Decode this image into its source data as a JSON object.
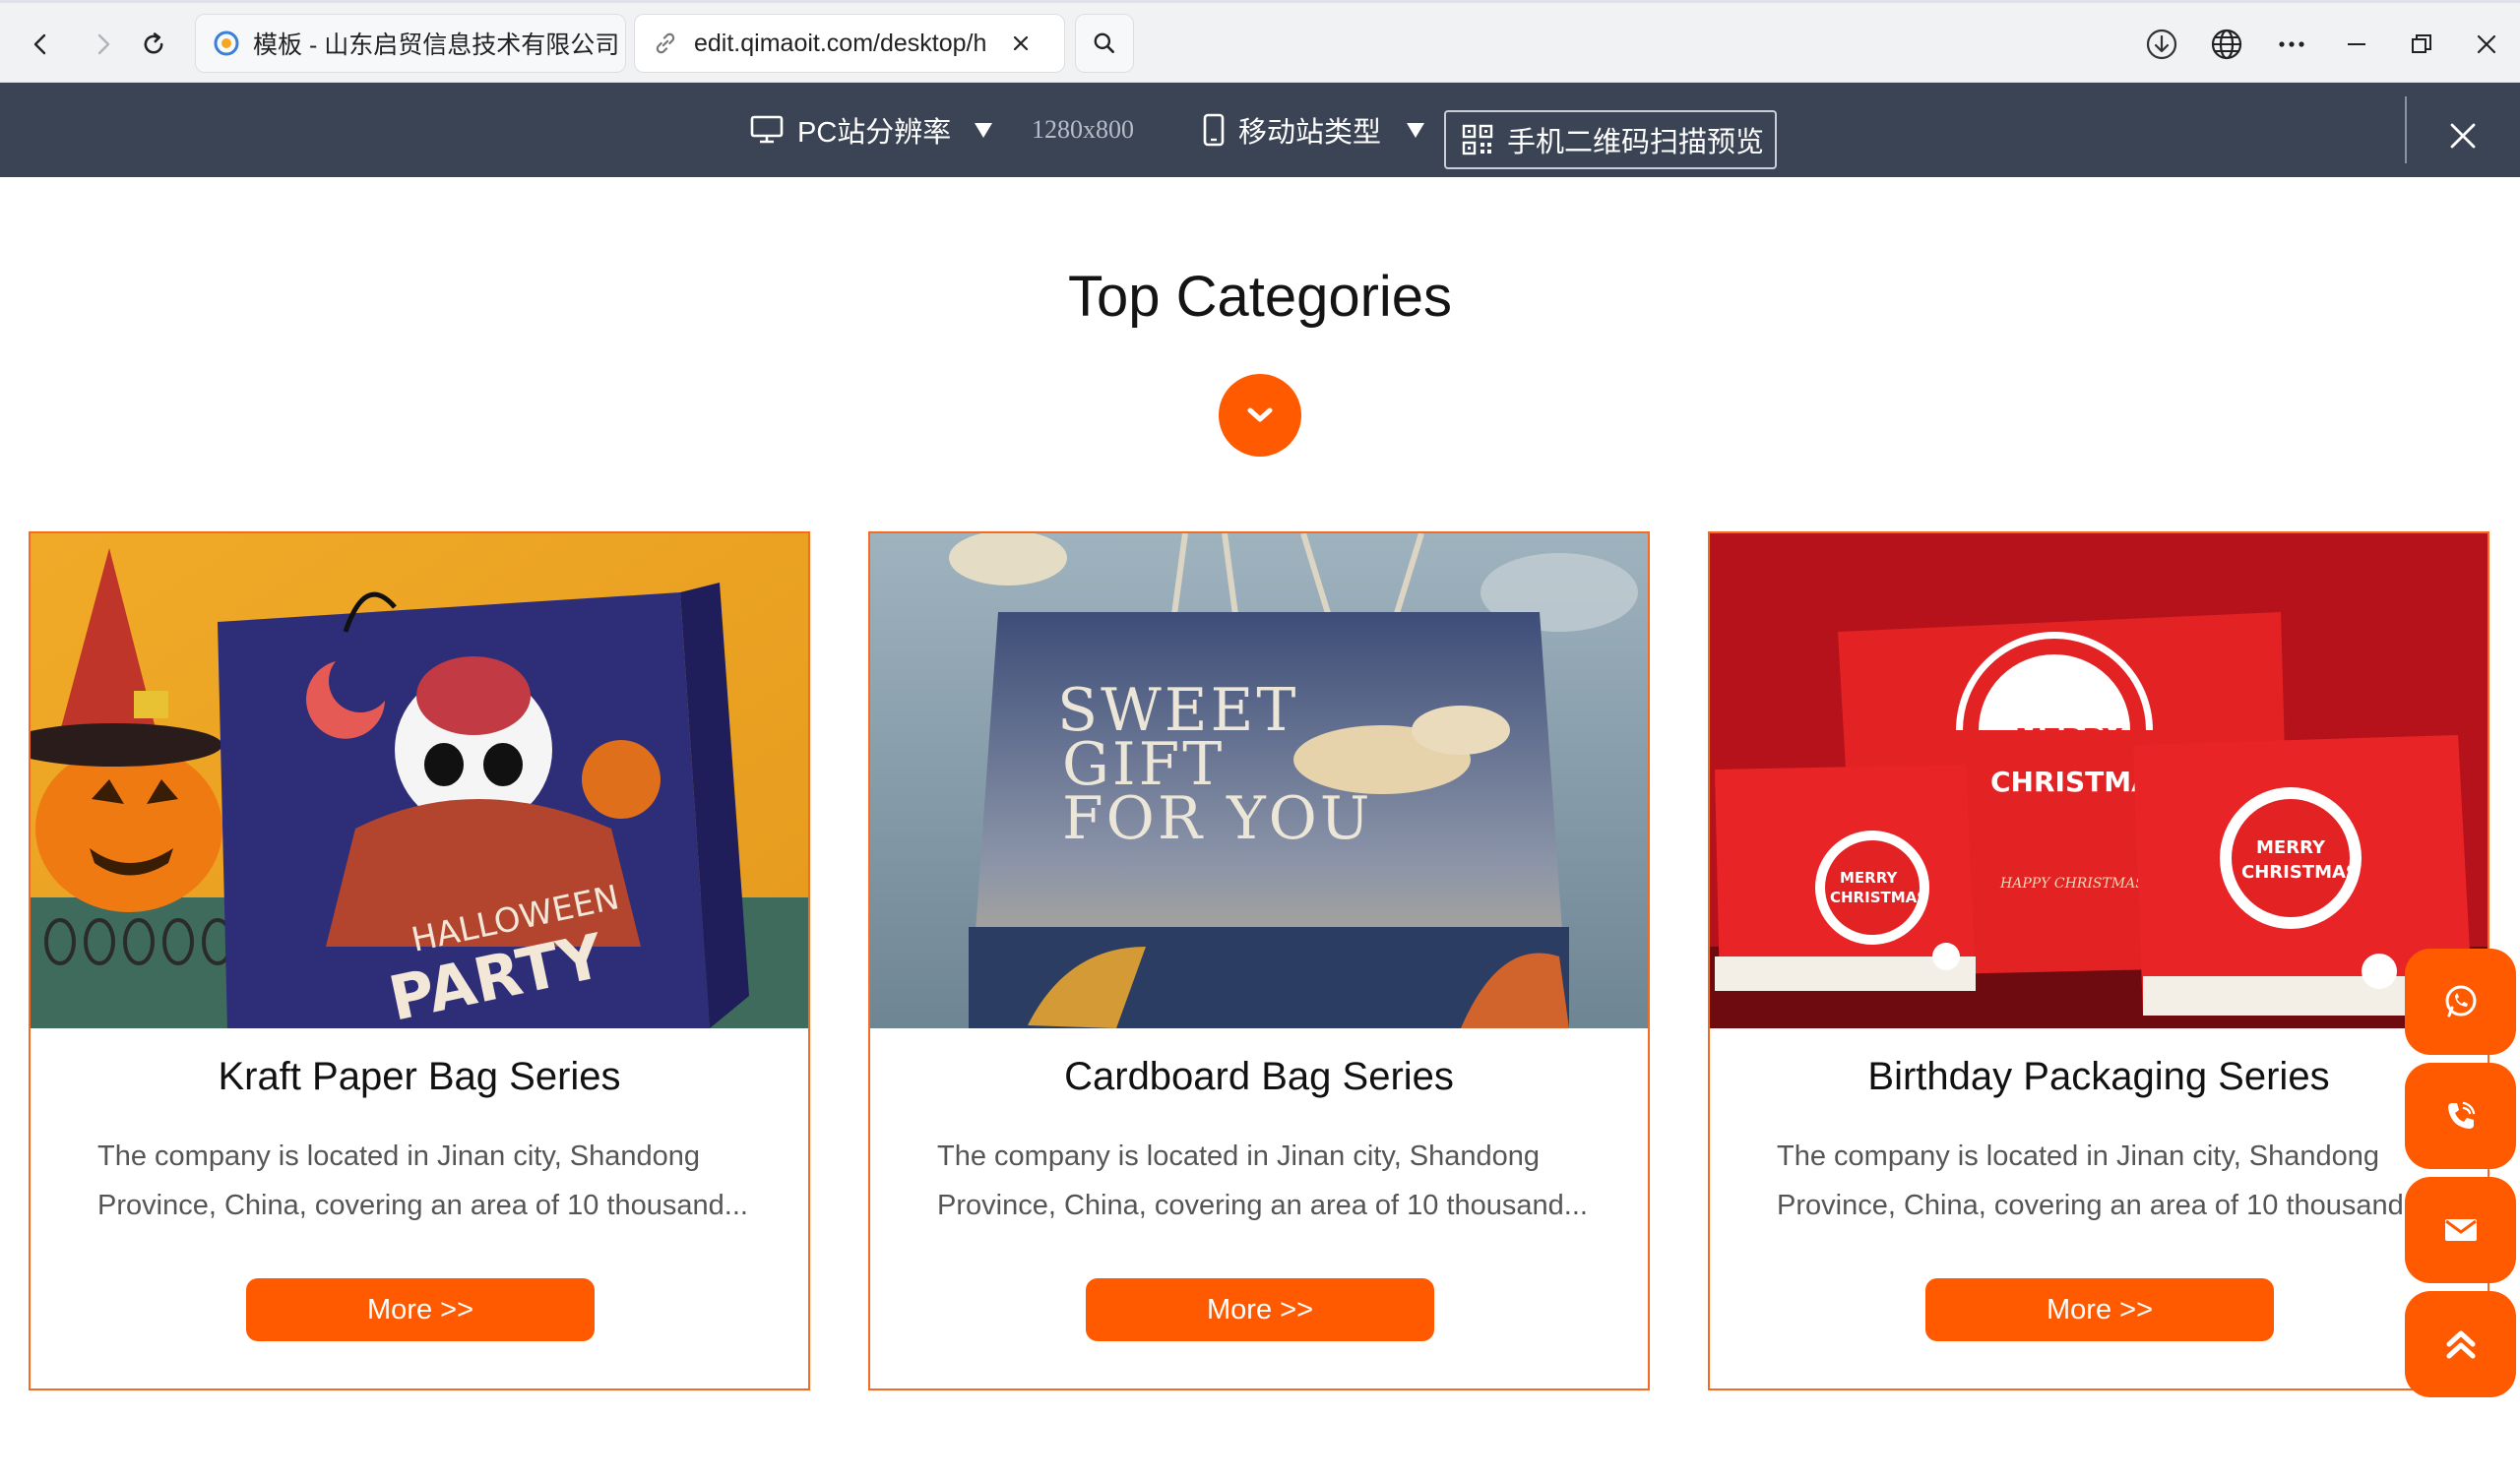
{
  "browser": {
    "tabs": [
      {
        "title": "模板 - 山东启贸信息技术有限公司",
        "active": false
      },
      {
        "title": "edit.qimaoit.com/desktop/h",
        "active": true
      }
    ],
    "icons": [
      "back-icon",
      "forward-icon",
      "reload-icon",
      "search-icon",
      "download-icon",
      "globe-icon",
      "more-icon",
      "minimize-icon",
      "restore-icon",
      "close-icon"
    ]
  },
  "preview_toolbar": {
    "pc_label": "PC站分辨率",
    "resolution": "1280x800",
    "mobile_label": "移动站类型",
    "qr_label": "手机二维码扫描预览"
  },
  "page": {
    "section_title": "Top Categories",
    "accent_color": "#ff5a00",
    "cards": [
      {
        "title": "Kraft Paper Bag Series",
        "description": "The company is located in Jinan city, Shandong Province, China, covering an area of 10 thousand...",
        "button": "More >>",
        "image": "halloween-party-bag"
      },
      {
        "title": "Cardboard Bag Series",
        "description": "The company is located in Jinan city, Shandong Province, China, covering an area of 10 thousand...",
        "button": "More >>",
        "image": "sweet-gift-for-you-bag"
      },
      {
        "title": "Birthday Packaging Series",
        "description": "The company is located in Jinan city, Shandong Province, China, covering an area of 10 thousand...",
        "button": "More >>",
        "image": "merry-christmas-bags"
      }
    ],
    "image_text": {
      "halloween_1": "HALLOWEEN",
      "halloween_2": "PARTY",
      "sweet_1": "SWEET",
      "sweet_2": "GIFT",
      "sweet_3": "FOR YOU",
      "xmas_1": "MERRY",
      "xmas_2": "CHRISTMA",
      "xmas_small_1": "MERRY",
      "xmas_small_2": "CHRISTMAS",
      "xmas_happy": "HAPPY CHRISTMAS"
    },
    "floating_actions": [
      "whatsapp-icon",
      "phone-icon",
      "mail-icon",
      "back-to-top-icon"
    ]
  }
}
